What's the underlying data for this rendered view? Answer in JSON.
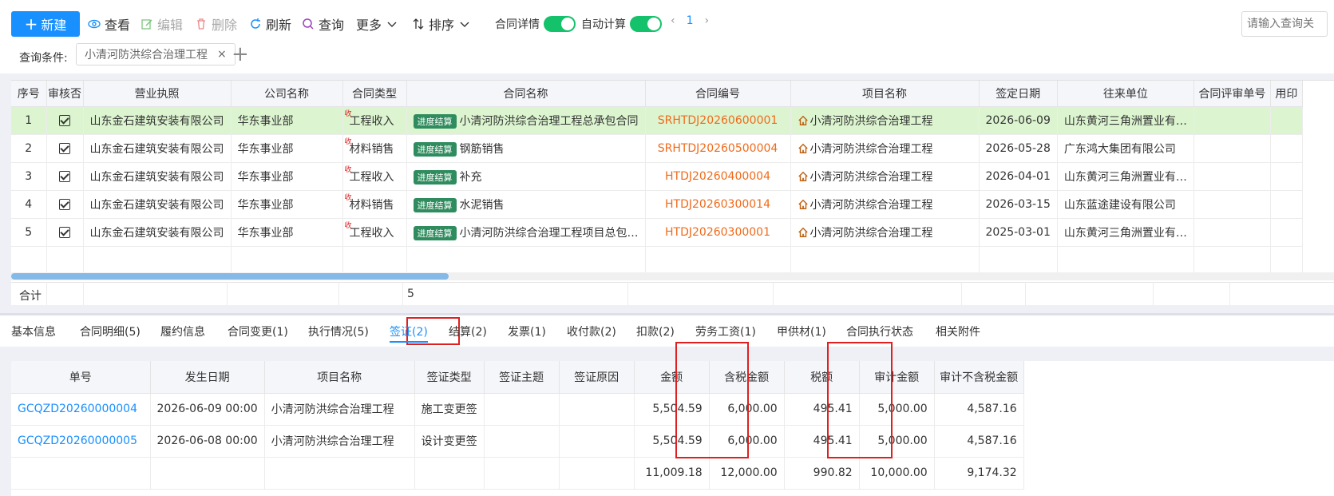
{
  "toolbar": {
    "new_label": "新建",
    "view_label": "查看",
    "edit_label": "编辑",
    "delete_label": "删除",
    "refresh_label": "刷新",
    "query_label": "查询",
    "more_label": "更多",
    "sort_label": "排序",
    "contract_detail_label": "合同详情",
    "auto_calc_label": "自动计算",
    "page": "1",
    "search_placeholder": "请输入查询关",
    "accent": "#1890ff",
    "toggle_color": "#13c26b",
    "contract_detail_on": true,
    "auto_calc_on": true
  },
  "query": {
    "label": "查询条件:",
    "tag": "小清河防洪综合治理工程",
    "tag_close": "×",
    "add": "+"
  },
  "grid": {
    "columns": [
      "序号",
      "审核否",
      "营业执照",
      "公司名称",
      "合同类型",
      "合同名称",
      "合同编号",
      "项目名称",
      "签定日期",
      "往来单位",
      "合同评审单号",
      "用印"
    ],
    "rows": [
      {
        "no": "1",
        "license": "山东金石建筑安装有限公司",
        "company": "华东事业部",
        "mark": "收",
        "type": "工程收入",
        "badge": "进度结算",
        "name": "小清河防洪综合治理工程总承包合同",
        "code": "SRHTDJ20260600001",
        "project": "小清河防洪综合治理工程",
        "date": "2026-06-09",
        "partner": "山东黄河三角洲置业有…",
        "selected": true
      },
      {
        "no": "2",
        "license": "山东金石建筑安装有限公司",
        "company": "华东事业部",
        "mark": "收",
        "type": "材料销售",
        "badge": "进度结算",
        "name": "钢筋销售",
        "code": "SRHTDJ20260500004",
        "project": "小清河防洪综合治理工程",
        "date": "2026-05-28",
        "partner": "广东鸿大集团有限公司",
        "selected": false
      },
      {
        "no": "3",
        "license": "山东金石建筑安装有限公司",
        "company": "华东事业部",
        "mark": "收",
        "type": "工程收入",
        "badge": "进度结算",
        "name": "补充",
        "code": "HTDJ20260400004",
        "project": "小清河防洪综合治理工程",
        "date": "2026-04-01",
        "partner": "山东黄河三角洲置业有…",
        "selected": false
      },
      {
        "no": "4",
        "license": "山东金石建筑安装有限公司",
        "company": "华东事业部",
        "mark": "收",
        "type": "材料销售",
        "badge": "进度结算",
        "name": "水泥销售",
        "code": "HTDJ20260300014",
        "project": "小清河防洪综合治理工程",
        "date": "2026-03-15",
        "partner": "山东蓝途建设有限公司",
        "selected": false
      },
      {
        "no": "5",
        "license": "山东金石建筑安装有限公司",
        "company": "华东事业部",
        "mark": "收",
        "type": "工程收入",
        "badge": "进度结算",
        "name": "小清河防洪综合治理工程项目总包…",
        "code": "HTDJ20260300001",
        "project": "小清河防洪综合治理工程",
        "date": "2025-03-01",
        "partner": "山东黄河三角洲置业有…",
        "selected": false
      }
    ],
    "total_label": "合计",
    "total_count": "5",
    "selected_row_color": "#dcf5d0",
    "code_color": "#f06a1a"
  },
  "tabs": [
    "基本信息",
    "合同明细(5)",
    "履约信息",
    "合同变更(1)",
    "执行情况(5)",
    "签证(2)",
    "结算(2)",
    "发票(1)",
    "收付款(2)",
    "扣款(2)",
    "劳务工资(1)",
    "甲供材(1)",
    "合同执行状态",
    "相关附件"
  ],
  "active_tab": "签证(2)",
  "detail": {
    "columns": [
      "单号",
      "发生日期",
      "项目名称",
      "签证类型",
      "签证主题",
      "签证原因",
      "金额",
      "含税金额",
      "税额",
      "审计金额",
      "审计不含税金额"
    ],
    "rows": [
      {
        "code": "GCQZD20260000004",
        "date": "2026-06-09 00:00",
        "project": "小清河防洪综合治理工程",
        "type": "施工变更签",
        "amount": "5,504.59",
        "tax_incl": "6,000.00",
        "tax": "495.41",
        "audit": "5,000.00",
        "audit_excl": "4,587.16"
      },
      {
        "code": "GCQZD20260000005",
        "date": "2026-06-08 00:00",
        "project": "小清河防洪综合治理工程",
        "type": "设计变更签",
        "amount": "5,504.59",
        "tax_incl": "6,000.00",
        "tax": "495.41",
        "audit": "5,000.00",
        "audit_excl": "4,587.16"
      }
    ],
    "totals": {
      "amount": "11,009.18",
      "tax_incl": "12,000.00",
      "tax": "990.82",
      "audit": "10,000.00",
      "audit_excl": "9,174.32"
    }
  }
}
